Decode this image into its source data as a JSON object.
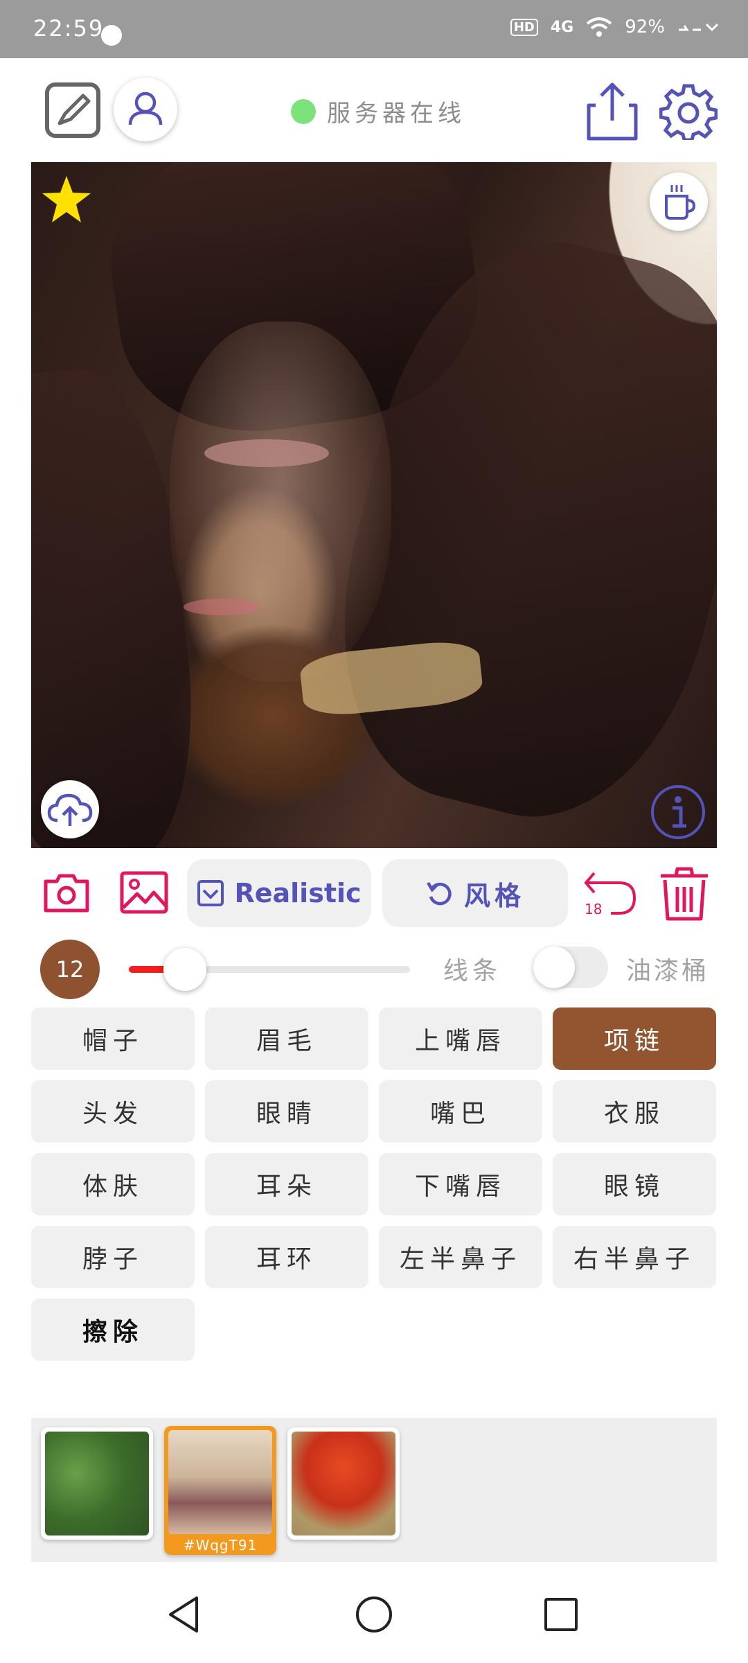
{
  "status_bar": {
    "time": "22:59",
    "network": "4G",
    "hd": "HD",
    "battery": "92%"
  },
  "header": {
    "server_status": "服务器在线",
    "server_color": "#7ce37a",
    "accent": "#5453b8"
  },
  "canvas": {
    "favorite_icon": "star-icon",
    "coffee_icon": "coffee-icon",
    "upload_icon": "cloud-upload-icon",
    "info_icon": "info-icon"
  },
  "toolbar": {
    "mode_label": "Realistic",
    "style_label": "风格",
    "undo_count": "18",
    "accent_red": "#e0175f"
  },
  "brush": {
    "size": "12",
    "level_fraction": 0.2,
    "line_label": "线条",
    "bucket_label": "油漆桶",
    "bucket_enabled": false
  },
  "parts": [
    {
      "label": "帽子"
    },
    {
      "label": "眉毛"
    },
    {
      "label": "上嘴唇"
    },
    {
      "label": "项链",
      "active": true
    },
    {
      "label": "头发"
    },
    {
      "label": "眼睛"
    },
    {
      "label": "嘴巴"
    },
    {
      "label": "衣服"
    },
    {
      "label": "体肤"
    },
    {
      "label": "耳朵"
    },
    {
      "label": "下嘴唇"
    },
    {
      "label": "眼镜"
    },
    {
      "label": "脖子"
    },
    {
      "label": "耳环"
    },
    {
      "label": "左半鼻子"
    },
    {
      "label": "右半鼻子"
    },
    {
      "label": "擦除",
      "bold": true
    }
  ],
  "gallery": {
    "selected_caption": "#WqgT91"
  }
}
